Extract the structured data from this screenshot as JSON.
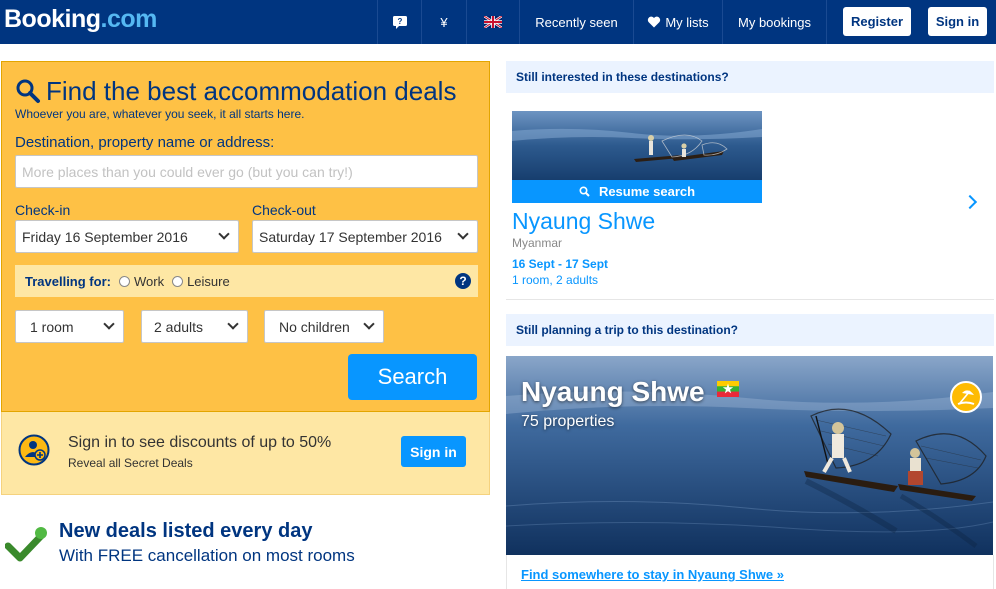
{
  "header": {
    "logo_main": "Booking",
    "logo_suffix": ".com",
    "currency": "¥",
    "recently_seen": "Recently seen",
    "my_lists": "My lists",
    "my_bookings": "My bookings",
    "register": "Register",
    "sign_in": "Sign in"
  },
  "search": {
    "title": "Find the best accommodation deals",
    "subtitle": "Whoever you are, whatever you seek, it all starts here.",
    "destination_label": "Destination, property name or address:",
    "destination_placeholder": "More places than you could ever go (but you can try!)",
    "checkin_label": "Check-in",
    "checkin_value": "Friday 16 September 2016",
    "checkout_label": "Check-out",
    "checkout_value": "Saturday 17 September 2016",
    "travelling_for_label": "Travelling for:",
    "option_work": "Work",
    "option_leisure": "Leisure",
    "help": "?",
    "rooms": "1 room",
    "adults": "2 adults",
    "children": "No children",
    "search_button": "Search"
  },
  "signin_promo": {
    "title": "Sign in to see discounts of up to 50%",
    "subtitle": "Reveal all Secret Deals",
    "button": "Sign in"
  },
  "deals": {
    "title": "New deals listed every day",
    "subtitle": "With FREE cancellation on most rooms"
  },
  "recent": {
    "heading": "Still interested in these destinations?",
    "resume_button": "Resume search",
    "name": "Nyaung Shwe",
    "country": "Myanmar",
    "dates": "16 Sept - 17 Sept",
    "guests": "1 room, 2 adults"
  },
  "planning": {
    "heading": "Still planning a trip to this destination?",
    "name": "Nyaung Shwe",
    "properties": "75 properties",
    "link": "Find somewhere to stay in Nyaung Shwe »"
  },
  "colors": {
    "brand_blue": "#003580",
    "accent_blue": "#0896ff",
    "panel_yellow": "#febb02"
  }
}
